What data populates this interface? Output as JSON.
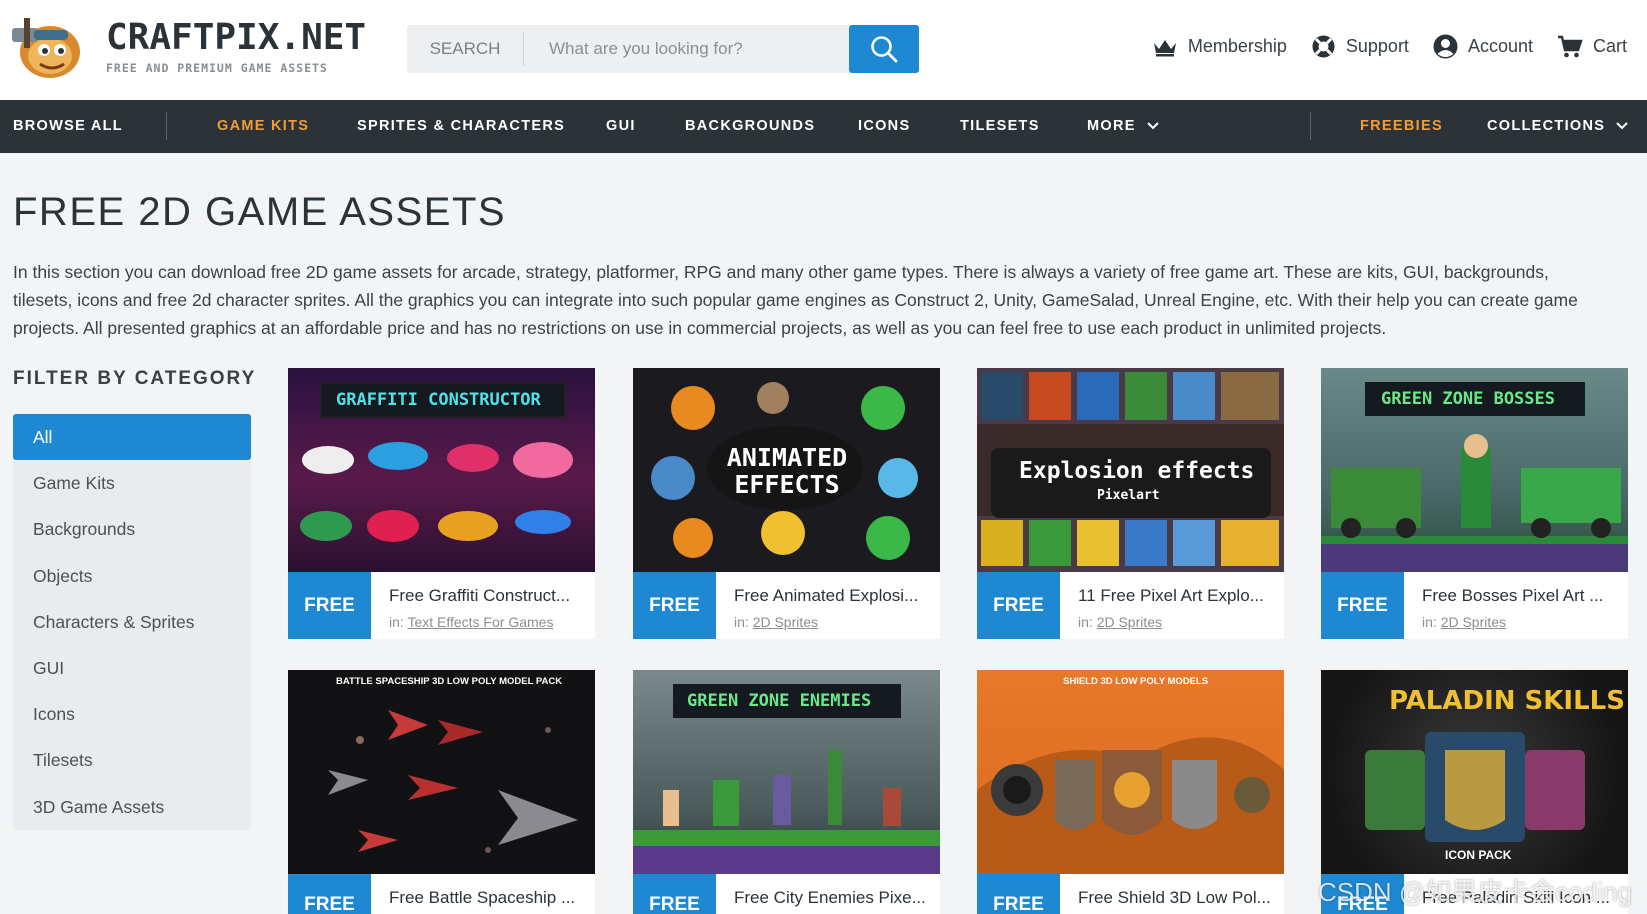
{
  "header": {
    "logo_title": "CRAFTPIX.NET",
    "logo_subtitle": "FREE AND PREMIUM GAME ASSETS",
    "search_label": "SEARCH",
    "search_placeholder": "What are you looking for?",
    "links": {
      "membership": "Membership",
      "support": "Support",
      "account": "Account",
      "cart": "Cart"
    }
  },
  "nav": {
    "browse_all": "BROWSE ALL",
    "game_kits": "GAME KITS",
    "sprites": "SPRITES & CHARACTERS",
    "gui": "GUI",
    "backgrounds": "BACKGROUNDS",
    "icons": "ICONS",
    "tilesets": "TILESETS",
    "more": "MORE",
    "freebies": "FREEBIES",
    "collections": "COLLECTIONS"
  },
  "colors": {
    "accent_blue": "#1e88d2",
    "nav_bg": "#2b3338",
    "orange": "#f29c38"
  },
  "main": {
    "title": "FREE 2D GAME ASSETS",
    "intro": "In this section you can download free 2D game assets for arcade, strategy, platformer, RPG and many other game types. There is always a variety of free game art. These are kits, GUI, backgrounds, tilesets, icons and free 2d character sprites. All the graphics you can integrate into such popular game engines as Construct 2, Unity, GameSalad, Unreal Engine, etc. With their help you can create game projects. All presented graphics at an affordable price and has no restrictions on use in commercial projects, as well as you can feel free to use each product in unlimited projects."
  },
  "filter": {
    "title": "FILTER BY CATEGORY",
    "items": [
      "All",
      "Game Kits",
      "Backgrounds",
      "Objects",
      "Characters & Sprites",
      "GUI",
      "Icons",
      "Tilesets",
      "3D Game Assets"
    ]
  },
  "cards": [
    {
      "badge": "FREE",
      "title": "Free Graffiti Construct...",
      "in": "in:",
      "category": "Text Effects For Games",
      "thumb_text": "GRAFFITI CONSTRUCTOR"
    },
    {
      "badge": "FREE",
      "title": "Free Animated Explosi...",
      "in": "in:",
      "category": "2D Sprites",
      "thumb_text": "ANIMATED EFFECTS"
    },
    {
      "badge": "FREE",
      "title": "11 Free Pixel Art Explo...",
      "in": "in:",
      "category": "2D Sprites",
      "thumb_text": "Explosion effects",
      "thumb_sub": "Pixelart"
    },
    {
      "badge": "FREE",
      "title": "Free Bosses Pixel Art ...",
      "in": "in:",
      "category": "2D Sprites",
      "thumb_text": "GREEN ZONE BOSSES"
    },
    {
      "badge": "FREE",
      "title": "Free Battle Spaceship ...",
      "thumb_text": "BATTLE SPACESHIP 3D LOW POLY MODEL PACK"
    },
    {
      "badge": "FREE",
      "title": "Free City Enemies Pixe...",
      "thumb_text": "GREEN ZONE ENEMIES"
    },
    {
      "badge": "FREE",
      "title": "Free Shield 3D Low Pol...",
      "thumb_text": "SHIELD 3D LOW POLY MODELS"
    },
    {
      "badge": "FREE",
      "title": "Free Paladin Skill Icon ...",
      "thumb_text": "PALADIN SKILLS",
      "thumb_sub": "ICON PACK"
    }
  ],
  "watermark": "CSDN @如果皮卡会coding"
}
